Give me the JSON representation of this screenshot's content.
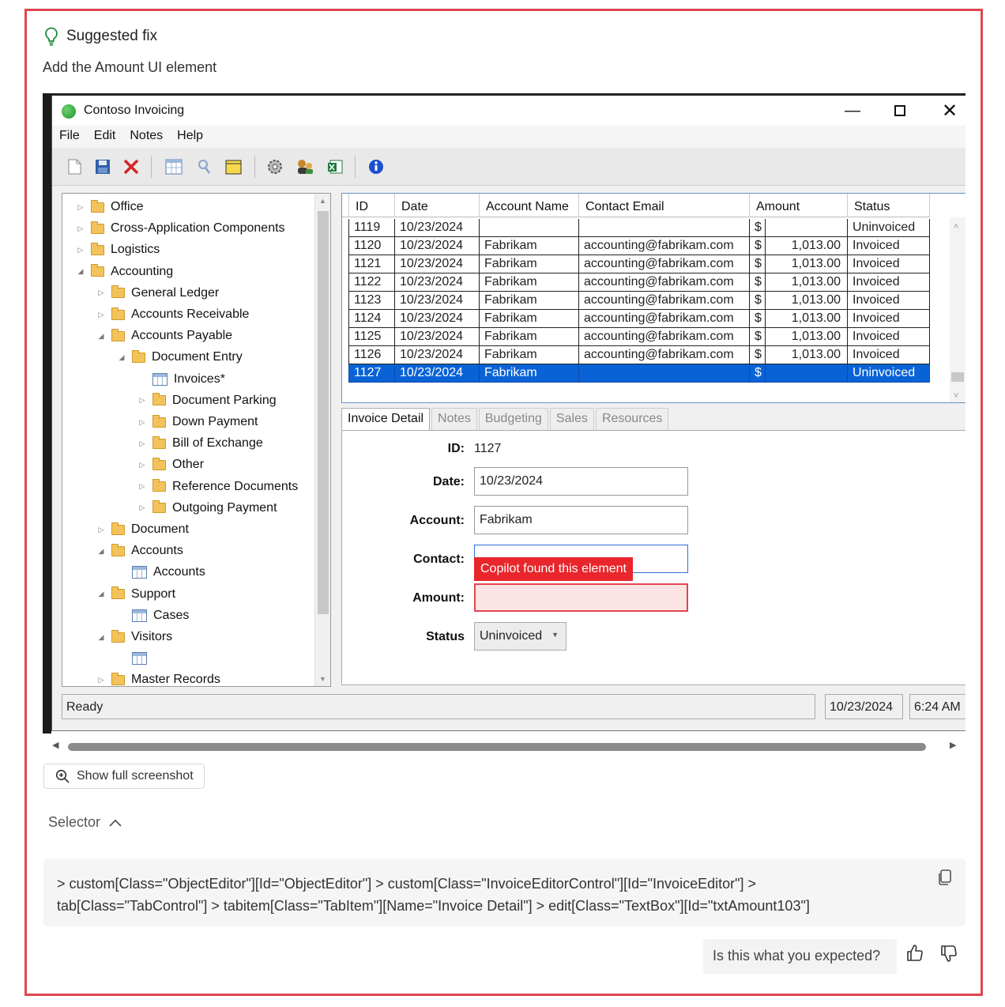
{
  "header": {
    "title": "Suggested fix",
    "subtitle": "Add the Amount UI element",
    "icon": "lightbulb-icon"
  },
  "app": {
    "window_title": "Contoso Invoicing",
    "menu": [
      "File",
      "Edit",
      "Notes",
      "Help"
    ],
    "tree": [
      {
        "label": "Office",
        "level": 0,
        "expanded": false,
        "icon": "folder"
      },
      {
        "label": "Cross-Application Components",
        "level": 0,
        "expanded": false,
        "icon": "folder"
      },
      {
        "label": "Logistics",
        "level": 0,
        "expanded": false,
        "icon": "folder"
      },
      {
        "label": "Accounting",
        "level": 0,
        "expanded": true,
        "icon": "folder-open"
      },
      {
        "label": "General Ledger",
        "level": 1,
        "expanded": false,
        "icon": "folder"
      },
      {
        "label": "Accounts Receivable",
        "level": 1,
        "expanded": false,
        "icon": "folder"
      },
      {
        "label": "Accounts Payable",
        "level": 1,
        "expanded": true,
        "icon": "folder-open"
      },
      {
        "label": "Document Entry",
        "level": 2,
        "expanded": true,
        "icon": "folder-open"
      },
      {
        "label": "Invoices*",
        "level": 3,
        "expanded": null,
        "icon": "grid"
      },
      {
        "label": "Document Parking",
        "level": 3,
        "expanded": false,
        "icon": "folder"
      },
      {
        "label": "Down Payment",
        "level": 3,
        "expanded": false,
        "icon": "folder"
      },
      {
        "label": "Bill of Exchange",
        "level": 3,
        "expanded": false,
        "icon": "folder"
      },
      {
        "label": "Other",
        "level": 3,
        "expanded": false,
        "icon": "folder"
      },
      {
        "label": "Reference Documents",
        "level": 3,
        "expanded": false,
        "icon": "folder"
      },
      {
        "label": "Outgoing Payment",
        "level": 3,
        "expanded": false,
        "icon": "folder"
      },
      {
        "label": "Document",
        "level": 1,
        "expanded": false,
        "icon": "folder"
      },
      {
        "label": "Accounts",
        "level": 1,
        "expanded": true,
        "icon": "folder-open"
      },
      {
        "label": "Accounts",
        "level": 2,
        "expanded": null,
        "icon": "grid"
      },
      {
        "label": "Support",
        "level": 1,
        "expanded": true,
        "icon": "folder-open"
      },
      {
        "label": "Cases",
        "level": 2,
        "expanded": null,
        "icon": "grid"
      },
      {
        "label": "Visitors",
        "level": 1,
        "expanded": true,
        "icon": "folder-open"
      },
      {
        "label": "",
        "level": 2,
        "expanded": null,
        "icon": "grid"
      },
      {
        "label": "Master Records",
        "level": 1,
        "expanded": false,
        "icon": "folder"
      }
    ],
    "grid": {
      "columns": [
        "ID",
        "Date",
        "Account Name",
        "Contact Email",
        "Amount",
        "Status"
      ],
      "rows": [
        [
          "1119",
          "10/23/2024",
          "",
          "",
          "$",
          "",
          "Uninvoiced"
        ],
        [
          "1120",
          "10/23/2024",
          "Fabrikam",
          "accounting@fabrikam.com",
          "$",
          "1,013.00",
          "Invoiced"
        ],
        [
          "1121",
          "10/23/2024",
          "Fabrikam",
          "accounting@fabrikam.com",
          "$",
          "1,013.00",
          "Invoiced"
        ],
        [
          "1122",
          "10/23/2024",
          "Fabrikam",
          "accounting@fabrikam.com",
          "$",
          "1,013.00",
          "Invoiced"
        ],
        [
          "1123",
          "10/23/2024",
          "Fabrikam",
          "accounting@fabrikam.com",
          "$",
          "1,013.00",
          "Invoiced"
        ],
        [
          "1124",
          "10/23/2024",
          "Fabrikam",
          "accounting@fabrikam.com",
          "$",
          "1,013.00",
          "Invoiced"
        ],
        [
          "1125",
          "10/23/2024",
          "Fabrikam",
          "accounting@fabrikam.com",
          "$",
          "1,013.00",
          "Invoiced"
        ],
        [
          "1126",
          "10/23/2024",
          "Fabrikam",
          "accounting@fabrikam.com",
          "$",
          "1,013.00",
          "Invoiced"
        ],
        [
          "1127",
          "10/23/2024",
          "Fabrikam",
          "",
          "$",
          "",
          "Uninvoiced"
        ]
      ],
      "selected_row": 8
    },
    "tabs": [
      "Invoice Detail",
      "Notes",
      "Budgeting",
      "Sales",
      "Resources"
    ],
    "detail": {
      "id_label": "ID:",
      "id_value": "1127",
      "date_label": "Date:",
      "date_value": "10/23/2024",
      "account_label": "Account:",
      "account_value": "Fabrikam",
      "contact_label": "Contact:",
      "contact_value": "",
      "amount_label": "Amount:",
      "amount_value": "",
      "status_label": "Status",
      "status_value": "Uninvoiced",
      "highlight_text": "Copilot found this element"
    },
    "statusbar": {
      "text": "Ready",
      "date": "10/23/2024",
      "time": "6:24 AM"
    }
  },
  "show_full_label": "Show full screenshot",
  "selector": {
    "label": "Selector",
    "line1": "> custom[Class=\"ObjectEditor\"][Id=\"ObjectEditor\"] > custom[Class=\"InvoiceEditorControl\"][Id=\"InvoiceEditor\"] >",
    "line2": "tab[Class=\"TabControl\"] > tabitem[Class=\"TabItem\"][Name=\"Invoice Detail\"] > edit[Class=\"TextBox\"][Id=\"txtAmount103\"]"
  },
  "feedback": {
    "question": "Is this what you expected?"
  },
  "colors": {
    "frame": "#e0464f",
    "selection": "#0a63d6",
    "highlight": "#e8262b"
  }
}
